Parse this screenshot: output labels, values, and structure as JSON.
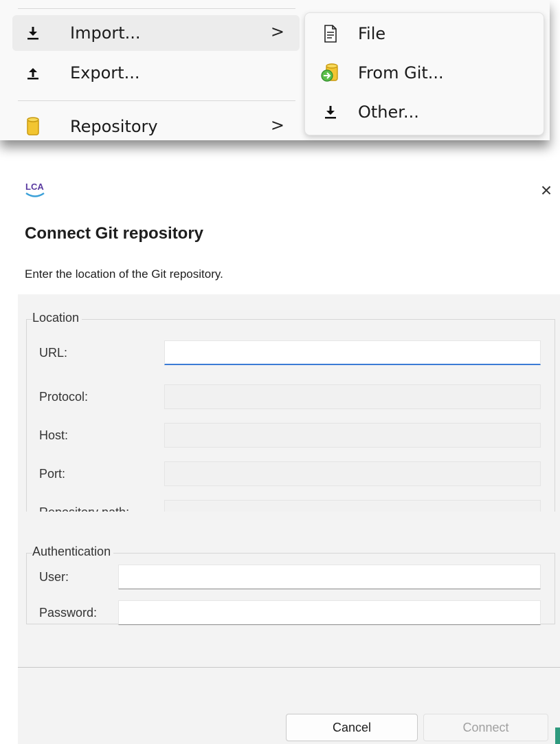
{
  "context_menu": {
    "items": [
      {
        "label": "Import...",
        "icon": "download-icon",
        "has_submenu": true,
        "chevron": ">"
      },
      {
        "label": "Export...",
        "icon": "upload-icon",
        "has_submenu": false
      },
      {
        "label": "Repository",
        "icon": "database-cylinder-icon",
        "has_submenu": true,
        "chevron": ">"
      }
    ],
    "submenu": {
      "items": [
        {
          "label": "File",
          "icon": "file-icon"
        },
        {
          "label": "From Git...",
          "icon": "git-import-icon"
        },
        {
          "label": "Other...",
          "icon": "download-icon"
        }
      ]
    }
  },
  "dialog": {
    "logo_text": "LCA",
    "close_glyph": "×",
    "title": "Connect Git repository",
    "description": "Enter the location of the Git repository.",
    "location_group": {
      "legend": "Location",
      "fields": [
        {
          "label": "URL:",
          "value": "",
          "enabled": true
        },
        {
          "label": "Protocol:",
          "value": "",
          "enabled": false
        },
        {
          "label": "Host:",
          "value": "",
          "enabled": false
        },
        {
          "label": "Port:",
          "value": "",
          "enabled": false
        },
        {
          "label": "Repository path:",
          "value": "",
          "enabled": false
        }
      ]
    },
    "auth_group": {
      "legend": "Authentication",
      "fields": [
        {
          "label": "User:",
          "value": "",
          "enabled": true
        },
        {
          "label": "Password:",
          "value": "",
          "enabled": true
        }
      ]
    },
    "buttons": {
      "cancel": "Cancel",
      "connect": "Connect"
    }
  },
  "colors": {
    "focus_underline": "#3a7bd5",
    "logo_purple": "#5a3aa0",
    "logo_blue": "#3aa0d8",
    "repository_icon": "#f2c531"
  }
}
